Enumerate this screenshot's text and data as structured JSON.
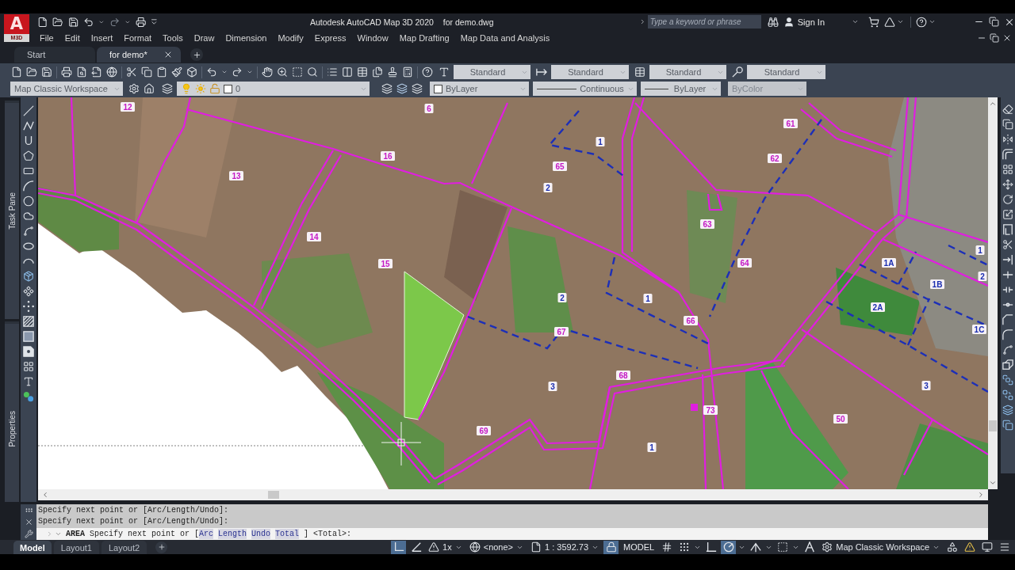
{
  "title_bar": {
    "logo_letter": "A",
    "logo_badge": "M3D",
    "title": "Autodesk AutoCAD Map 3D 2020",
    "document": "for demo.dwg",
    "search": {
      "placeholder": "Type a keyword or phrase"
    },
    "sign_in": "Sign In"
  },
  "menu": [
    "File",
    "Edit",
    "Insert",
    "Format",
    "Tools",
    "Draw",
    "Dimension",
    "Modify",
    "Express",
    "Window",
    "Map Drafting",
    "Map Data and Analysis"
  ],
  "doc_tabs": [
    {
      "label": "Start",
      "selected": false
    },
    {
      "label": "for demo*",
      "selected": true
    }
  ],
  "style_toolbar": [
    "Standard",
    "Standard",
    "Standard",
    "Standard"
  ],
  "properties_bar": {
    "workspace": "Map Classic Workspace",
    "layer": {
      "name": "0",
      "on": true,
      "frozen": false,
      "locked": false
    },
    "swatch_setting": "ByLayer",
    "linetype": "Continuous",
    "lineweight": "ByLayer",
    "plot_style": {
      "value": "ByColor",
      "disabled": true
    }
  },
  "palettes": [
    {
      "label": "Task Pane"
    },
    {
      "label": "Properties"
    }
  ],
  "map_labels": [
    {
      "text": "12",
      "color": "#c418c4"
    },
    {
      "text": "6",
      "color": "#c418c4"
    },
    {
      "text": "61",
      "color": "#c418c4"
    },
    {
      "text": "1",
      "color": "#1b2db0"
    },
    {
      "text": "16",
      "color": "#c418c4"
    },
    {
      "text": "62",
      "color": "#c418c4"
    },
    {
      "text": "65",
      "color": "#c418c4"
    },
    {
      "text": "13",
      "color": "#c418c4"
    },
    {
      "text": "2",
      "color": "#1b2db0"
    },
    {
      "text": "63",
      "color": "#c418c4"
    },
    {
      "text": "14",
      "color": "#c418c4"
    },
    {
      "text": "1",
      "color": "#1b2db0"
    },
    {
      "text": "15",
      "color": "#c418c4"
    },
    {
      "text": "64",
      "color": "#c418c4"
    },
    {
      "text": "1A",
      "color": "#1b2db0"
    },
    {
      "text": "2",
      "color": "#1b2db0"
    },
    {
      "text": "1B",
      "color": "#1b2db0"
    },
    {
      "text": "2",
      "color": "#1b2db0"
    },
    {
      "text": "1",
      "color": "#1b2db0"
    },
    {
      "text": "2A",
      "color": "#1b2db0"
    },
    {
      "text": "66",
      "color": "#c418c4"
    },
    {
      "text": "67",
      "color": "#c418c4"
    },
    {
      "text": "1C",
      "color": "#1b2db0"
    },
    {
      "text": "68",
      "color": "#c418c4"
    },
    {
      "text": "3",
      "color": "#1b2db0"
    },
    {
      "text": "3",
      "color": "#1b2db0"
    },
    {
      "text": "73",
      "color": "#c418c4"
    },
    {
      "text": "50",
      "color": "#c418c4"
    },
    {
      "text": "69",
      "color": "#c418c4"
    },
    {
      "text": "1",
      "color": "#1b2db0"
    }
  ],
  "command_line": {
    "history": [
      "Specify next point or [Arc/Length/Undo]:",
      "Specify next point or [Arc/Length/Undo]:"
    ],
    "command": "AREA",
    "prompt": "Specify next point or [",
    "options": [
      "Arc",
      "Length",
      "Undo",
      "Total"
    ],
    "prompt_end": "] <Total>:"
  },
  "layout_tabs": [
    {
      "label": "Model",
      "selected": true
    },
    {
      "label": "Layout1",
      "selected": false
    },
    {
      "label": "Layout2",
      "selected": false
    }
  ],
  "status_bar": [
    {
      "kind": "toggle",
      "on": true
    },
    {
      "kind": "toggle",
      "on": false
    },
    {
      "kind": "dropdown",
      "value": "1x"
    },
    {
      "kind": "dropdown",
      "value": "<none>"
    },
    {
      "kind": "dropdown",
      "value": "1 : 3592.73"
    },
    {
      "kind": "toggle",
      "on": true
    },
    {
      "kind": "label",
      "text": "MODEL"
    },
    {
      "kind": "toggle",
      "on": false
    },
    {
      "kind": "toggle",
      "on": false
    },
    {
      "kind": "toggle",
      "on": false
    },
    {
      "kind": "toggle",
      "on": true
    },
    {
      "kind": "toggle",
      "on": false
    },
    {
      "kind": "toggle",
      "on": false
    },
    {
      "kind": "toggle",
      "on": false
    },
    {
      "kind": "dropdown",
      "value": "Map Classic Workspace"
    },
    {
      "kind": "toggle",
      "on": false
    },
    {
      "kind": "button"
    },
    {
      "kind": "button"
    },
    {
      "kind": "button"
    }
  ]
}
